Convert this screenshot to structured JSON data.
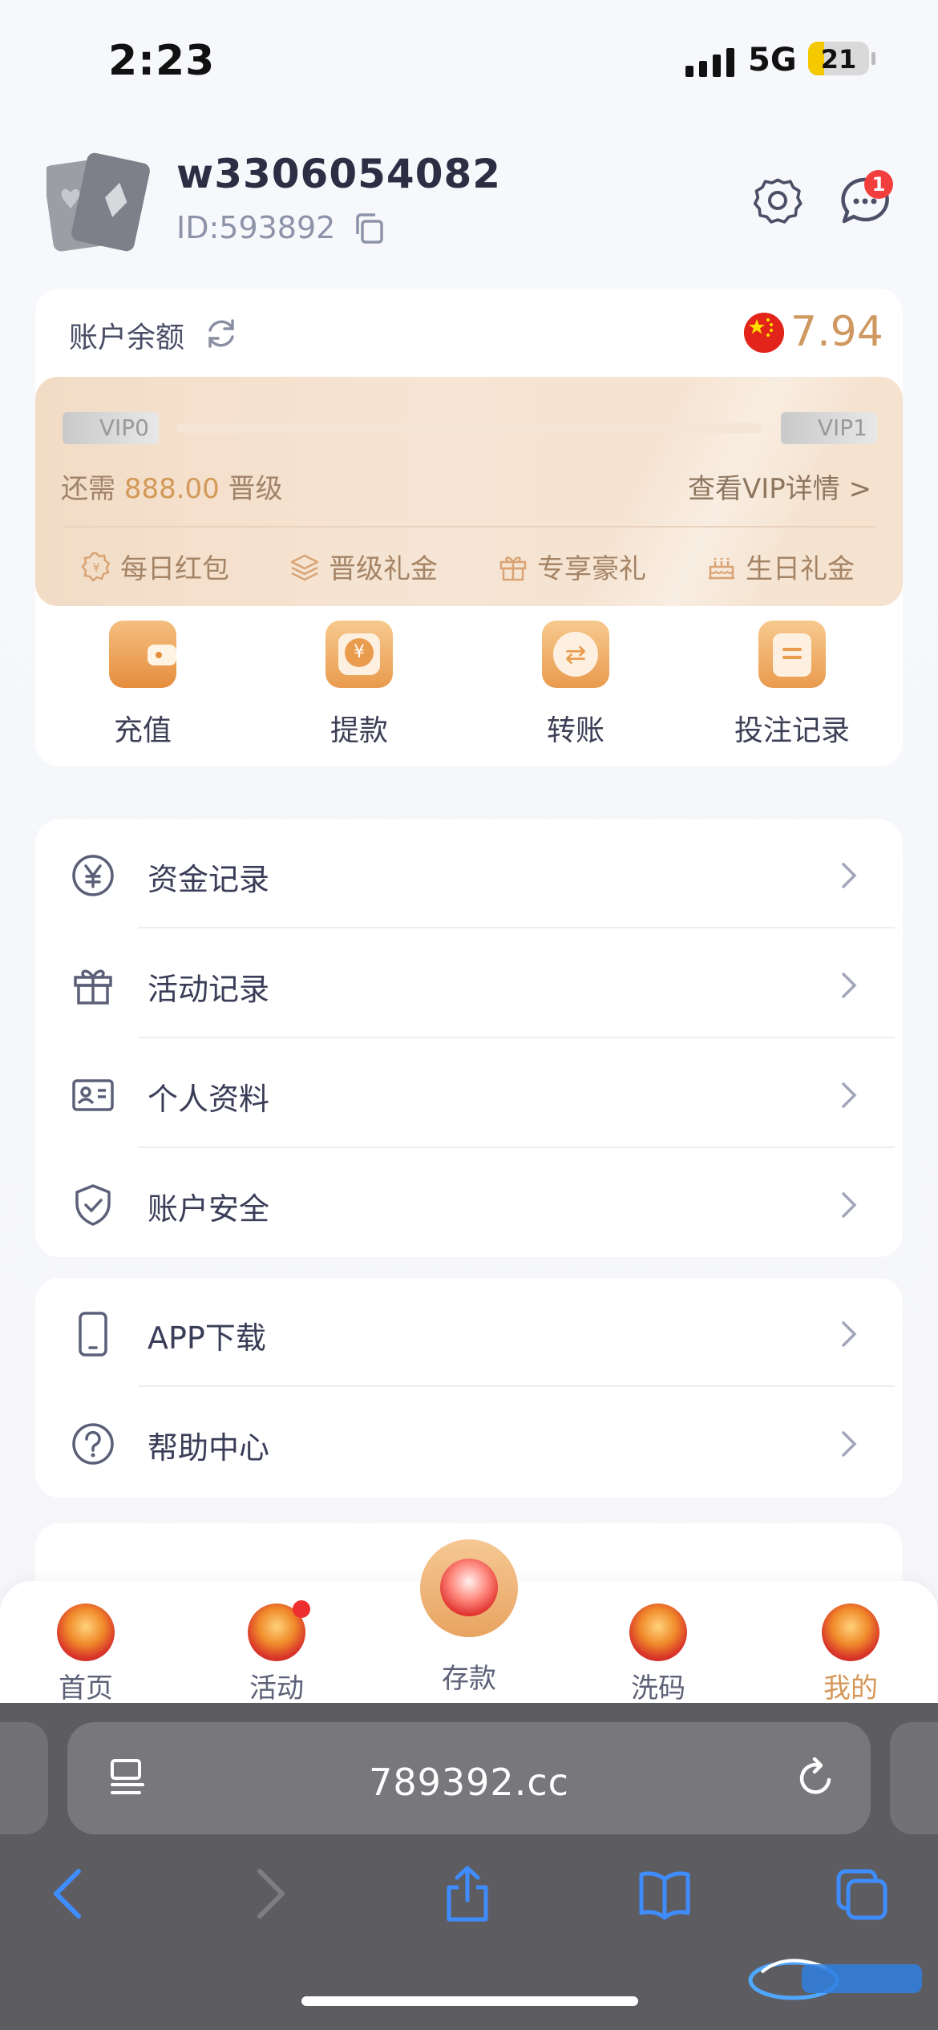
{
  "status_bar": {
    "time": "2:23",
    "network": "5G",
    "battery": "21"
  },
  "profile": {
    "username": "w3306054082",
    "id": "ID:593892",
    "notification_count": "1"
  },
  "balance": {
    "label": "账户余额",
    "value": "7.94"
  },
  "vip": {
    "current_level": "VIP0",
    "next_level": "VIP1",
    "progress": 0,
    "need_prefix": "还需",
    "need_amount": "888.00",
    "need_suffix": "晋级",
    "detail_link": "查看VIP详情 >",
    "perks": [
      "每日红包",
      "晋级礼金",
      "专享豪礼",
      "生日礼金"
    ]
  },
  "quick_actions": [
    "充值",
    "提款",
    "转账",
    "投注记录"
  ],
  "menu_group1": [
    "资金记录",
    "活动记录",
    "个人资料",
    "账户安全"
  ],
  "menu_group2": [
    "APP下载",
    "帮助中心"
  ],
  "tabbar": {
    "tabs": [
      "首页",
      "活动",
      "存款",
      "洗码",
      "我的"
    ],
    "active": "我的"
  },
  "browser": {
    "url": "789392.cc"
  },
  "colors": {
    "accent": "#d5985a",
    "gold": "#cf9860",
    "badge": "#f23d3d",
    "safari_bar": "#5d5d61"
  }
}
